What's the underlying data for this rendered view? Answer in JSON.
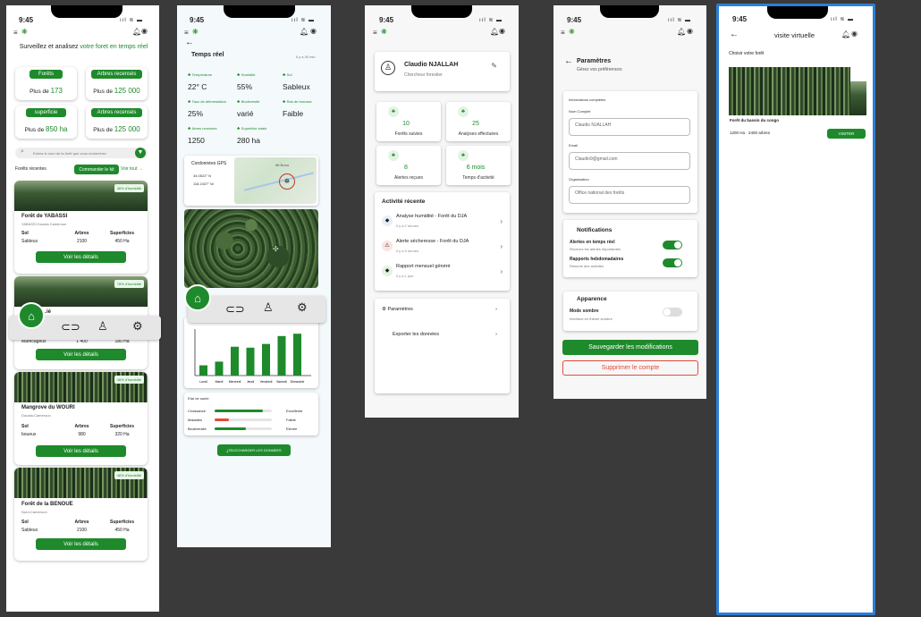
{
  "status": {
    "time": "9:45",
    "signal": "ııl ≋ ▬"
  },
  "s1": {
    "headline": "Surveillez et analisez",
    "headline_green": "votre foret en temps réel",
    "stats": [
      {
        "label": "Forêts",
        "prefix": "Plus de",
        "value": "173"
      },
      {
        "label": "Arbres recensés",
        "prefix": "Plus de",
        "value": "125 000"
      },
      {
        "label": "superficie",
        "prefix": "Plus de",
        "value": "850 ha"
      },
      {
        "label": "Arbres recensés",
        "prefix": "Plus de",
        "value": "125 000"
      }
    ],
    "search_placeholder": "Entrez le nom de la forêt que vous recherchez",
    "recent": "Forêts récentes",
    "order_kit": "Commander le kit",
    "see_all": "Voir tout →",
    "col_sol": "Sol",
    "col_arbres": "Arbres",
    "col_sup": "Superficies",
    "details": "Voir les détails",
    "forests": [
      {
        "tag": "46% d'humidité",
        "name": "Forêt de YABASSI",
        "loc": "YABASSI Douala Cameroun",
        "sol": "Sableux",
        "arbres": "2100",
        "sup": "450 Ha"
      },
      {
        "tag": "78% d'humidité",
        "name": "…ié",
        "loc": "",
        "sol": "Marécageux",
        "arbres": "1 400",
        "sup": "180 Ha"
      },
      {
        "tag": "46% d'humidité",
        "name": "Mangrove du WOURI",
        "loc": "Douala-Cameroun",
        "sol": "boueux",
        "arbres": "980",
        "sup": "320 Ha"
      },
      {
        "tag": "46% d'humidité",
        "name": "Forêt de la BENOUE",
        "loc": "Nord-Cameroun",
        "sol": "Sableux",
        "arbres": "2100",
        "sup": "450 Ha"
      }
    ]
  },
  "s2": {
    "title": "Temps réel",
    "ago": "Il y a 30 min",
    "metrics": [
      {
        "label": "Température",
        "value": "22° C"
      },
      {
        "label": "Humidité",
        "value": "55%"
      },
      {
        "label": "Sol",
        "value": "Sableux"
      },
      {
        "label": "Taux de déforestation",
        "value": "25%"
      },
      {
        "label": "Biodiversité",
        "value": "varié"
      },
      {
        "label": "Ras de brousse",
        "value": "Faible"
      },
      {
        "label": "Abres recensés",
        "value": "1250"
      },
      {
        "label": "Superficie totale",
        "value": "280 ha"
      }
    ],
    "gps_title": "Cordonnées GPS",
    "lat": "34.0522° N",
    "lng": "118.2437° W",
    "map_label": "Mt Buea",
    "nav_home": "ACCUEIL",
    "days": [
      "Lundi",
      "Mardi",
      "Mercredi",
      "Jeudi",
      "Vendredi",
      "Samedi",
      "Dimanche"
    ],
    "bars": [
      0.22,
      0.3,
      0.62,
      0.6,
      0.68,
      0.85,
      0.9
    ],
    "health_title": "Etat de santé",
    "health": [
      {
        "label": "Croissance",
        "value": "Excellente",
        "pct": 0.85,
        "color": "#1e8a2c"
      },
      {
        "label": "Maladies",
        "value": "Faible",
        "pct": 0.25,
        "color": "#e24b3a"
      },
      {
        "label": "Biodiversité",
        "value": "Elevée",
        "pct": 0.55,
        "color": "#1e8a2c"
      }
    ],
    "download": "TELECHARGER LES DONNEES"
  },
  "s3": {
    "name": "Claudio  NJALLAH",
    "role": "Chercheur forestier",
    "tiles": [
      {
        "value": "10",
        "label": "Forêts suivies"
      },
      {
        "value": "25",
        "label": "Analyses effectuées"
      },
      {
        "value": "8",
        "label": "Alertes reçues"
      },
      {
        "value": "6 mois",
        "label": "Temps d'activité"
      }
    ],
    "activity_title": "Activité récente",
    "activities": [
      {
        "title": "Analyse humidité - Forêt du DJA",
        "time": "Il y a 2 heures",
        "color": "#e6eef9"
      },
      {
        "title": "Alerte sécheresse - Forêt du DJA",
        "time": "Il y a 5 heures",
        "color": "#fbe3e1"
      },
      {
        "title": "Rapport mensuel généré",
        "time": "Il y a 1 jour",
        "color": "#e3f3e3"
      }
    ],
    "settings": "Paramètres",
    "export": "Exporter les données"
  },
  "s4": {
    "title": "Paramètres",
    "subtitle": "Gérez vos préférences",
    "info_title": "Informations complètes",
    "name_label": "Nom Complet",
    "name_value": "Claudio NJALLAH",
    "email_label": "Email",
    "email_value": "Claudio9@gmail.com",
    "org_label": "Organisation",
    "org_value": "Office national des forêts",
    "notif_title": "Notifications",
    "alerts_label": "Alertes en temps réel",
    "alerts_sub": "Recevez les alertes importantes",
    "reports_label": "Rapports hebdomadaires",
    "reports_sub": "Résumé des activités",
    "appearance_title": "Apparence",
    "dark_label": "Mode sombre",
    "dark_sub": "Interface en thème sombre",
    "save": "Sauvegarder les modifications",
    "delete": "Supprimer le compte"
  },
  "s5": {
    "title": "visite virtuelle",
    "choose": "Choisir votre forêt",
    "forest_name": "Forêt du bassin du congo",
    "area": "1200 Ha",
    "trees": "2400 arbres",
    "visit": "VISITER"
  }
}
